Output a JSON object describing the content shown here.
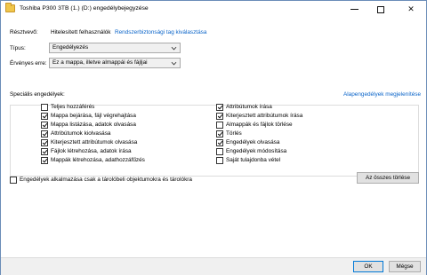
{
  "window": {
    "title": "Toshiba P300 3TB (1.) (D:) engedélybejegyzése"
  },
  "principal": {
    "label": "Résztvevő:",
    "value": "Hitelesített felhasználók",
    "select_link": "Rendszerbiztonsági tag kiválasztása"
  },
  "type": {
    "label": "Típus:",
    "value": "Engedélyezés"
  },
  "applies_to": {
    "label": "Érvényes erre:",
    "value": "Ez a mappa, illetve almappái és fájljai"
  },
  "special_permissions": {
    "label": "Speciális engedélyek:",
    "basic_link": "Alapengedélyek megjelenítése",
    "left_column": [
      {
        "label": "Teljes hozzáférés",
        "checked": false
      },
      {
        "label": "Mappa bejárása, fájl végrehajtása",
        "checked": true
      },
      {
        "label": "Mappa listázása, adatok olvasása",
        "checked": true
      },
      {
        "label": "Attribútumok kiolvasása",
        "checked": true
      },
      {
        "label": "Kiterjesztett attribútumok olvasása",
        "checked": true
      },
      {
        "label": "Fájlok létrehozása, adatok írása",
        "checked": true
      },
      {
        "label": "Mappák létrehozása, adathozzáfűzés",
        "checked": true
      }
    ],
    "right_column": [
      {
        "label": "Attribútumok írása",
        "checked": true
      },
      {
        "label": "Kiterjesztett attribútumok írása",
        "checked": true
      },
      {
        "label": "Almappák és fájlok törlése",
        "checked": false
      },
      {
        "label": "Törlés",
        "checked": true
      },
      {
        "label": "Engedélyek olvasása",
        "checked": true
      },
      {
        "label": "Engedélyek módosítása",
        "checked": false
      },
      {
        "label": "Saját tulajdonba vétel",
        "checked": false
      }
    ],
    "clear_all_button": "Az összes törlése"
  },
  "apply_only": {
    "label": "Engedélyek alkalmazása csak a tárolóbeli objektumokra és tárolókra",
    "checked": false
  },
  "footer": {
    "ok_label": "OK",
    "cancel_label": "Mégse"
  },
  "colors": {
    "link": "#0a64c9",
    "window_border": "#6b8db8",
    "footer_bg": "#f0f0f0",
    "primary_button_border": "#0078d7"
  },
  "icons": {
    "title": "folder-icon",
    "minimize": "minimize-icon",
    "maximize": "maximize-icon",
    "close": "close-icon"
  }
}
